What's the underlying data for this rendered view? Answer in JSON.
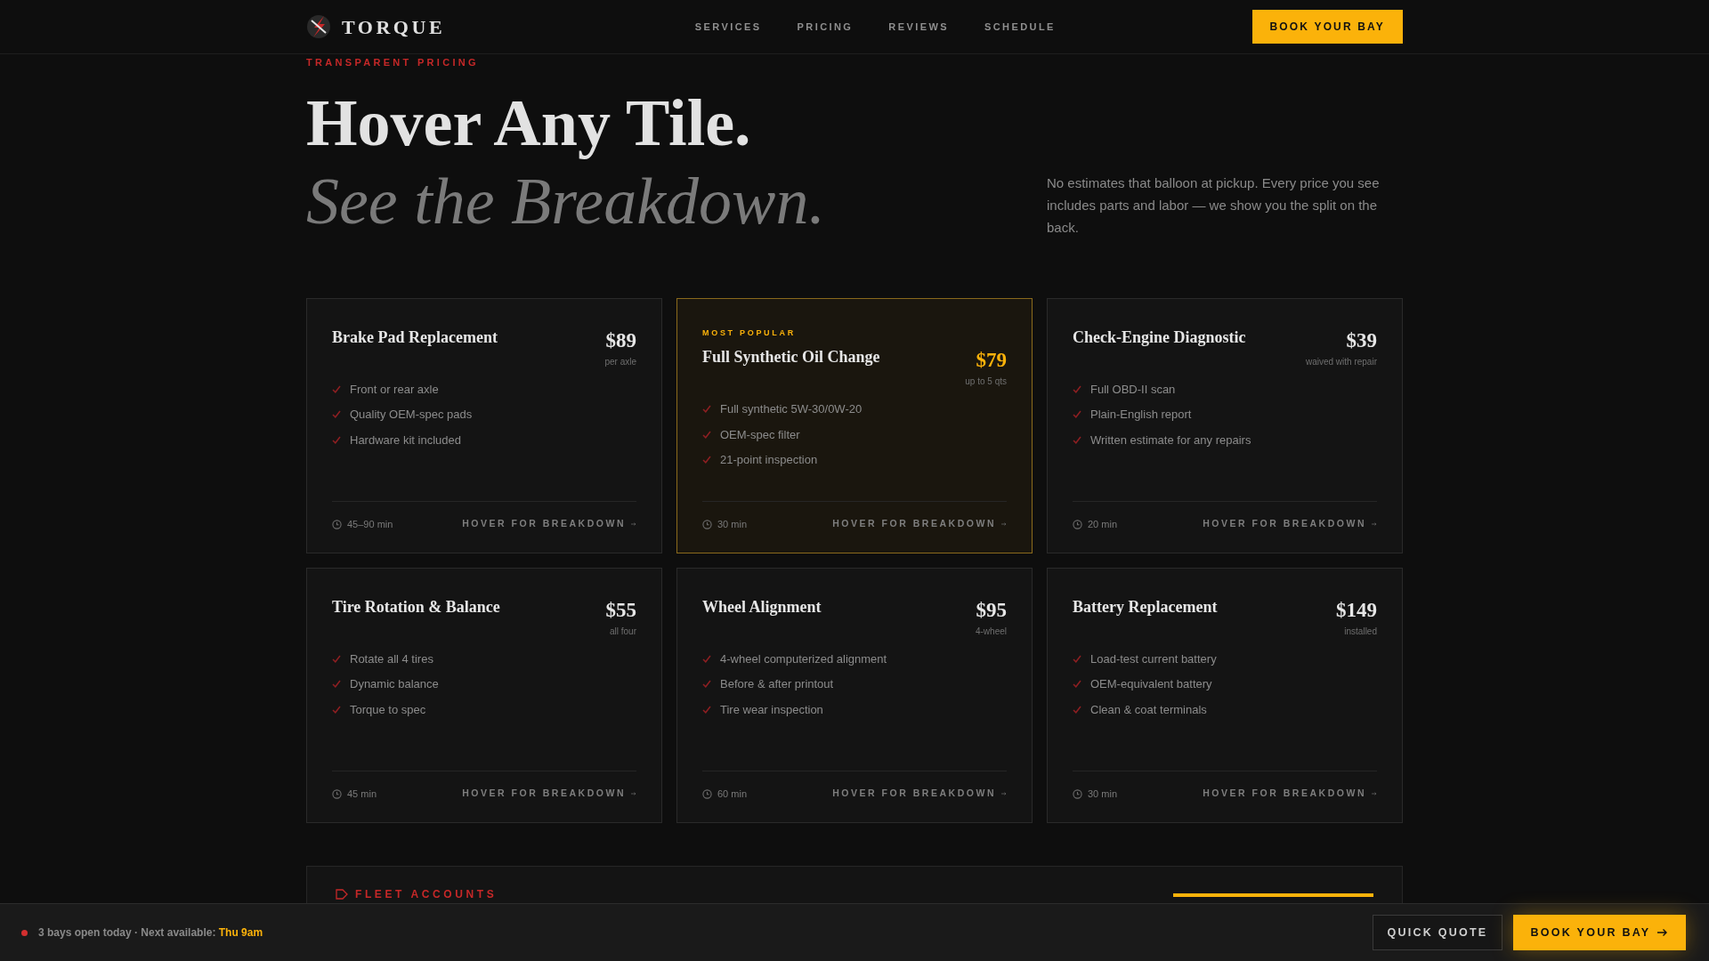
{
  "brand": {
    "name": "TORQUE"
  },
  "nav": [
    {
      "label": "SERVICES"
    },
    {
      "label": "PRICING"
    },
    {
      "label": "REVIEWS"
    },
    {
      "label": "SCHEDULE"
    }
  ],
  "header_button": "BOOK YOUR BAY",
  "eyebrow": "TRANSPARENT PRICING",
  "headline": "Hover Any Tile.",
  "subheadline": "See the Breakdown.",
  "intro": "No estimates that balloon at pickup. Every price you see includes parts and labor — we show you the split on the back.",
  "services": [
    {
      "title": "Brake Pad Replacement",
      "price": "$89",
      "unit": "per axle",
      "features": [
        "Front or rear axle",
        "Quality OEM-spec pads",
        "Hardware kit included"
      ],
      "duration": "45–90 min",
      "action": "HOVER FOR BREAKDOWN",
      "featured": false
    },
    {
      "title": "Full Synthetic Oil Change",
      "badge": "MOST POPULAR",
      "price": "$79",
      "unit": "up to 5 qts",
      "features": [
        "Full synthetic 5W-30/0W-20",
        "OEM-spec filter",
        "21-point inspection"
      ],
      "duration": "30 min",
      "action": "HOVER FOR BREAKDOWN",
      "featured": true
    },
    {
      "title": "Check-Engine Diagnostic",
      "price": "$39",
      "unit": "waived with repair",
      "features": [
        "Full OBD-II scan",
        "Plain-English report",
        "Written estimate for any repairs"
      ],
      "duration": "20 min",
      "action": "HOVER FOR BREAKDOWN",
      "featured": false
    },
    {
      "title": "Tire Rotation & Balance",
      "price": "$55",
      "unit": "all four",
      "features": [
        "Rotate all 4 tires",
        "Dynamic balance",
        "Torque to spec"
      ],
      "duration": "45 min",
      "action": "HOVER FOR BREAKDOWN",
      "featured": false
    },
    {
      "title": "Wheel Alignment",
      "price": "$95",
      "unit": "4-wheel",
      "features": [
        "4-wheel computerized alignment",
        "Before & after printout",
        "Tire wear inspection"
      ],
      "duration": "60 min",
      "action": "HOVER FOR BREAKDOWN",
      "featured": false
    },
    {
      "title": "Battery Replacement",
      "price": "$149",
      "unit": "installed",
      "features": [
        "Load-test current battery",
        "OEM-equivalent battery",
        "Clean & coat terminals"
      ],
      "duration": "30 min",
      "action": "HOVER FOR BREAKDOWN",
      "featured": false
    }
  ],
  "fleet": {
    "label": "FLEET ACCOUNTS"
  },
  "status_bar": {
    "text": "3 bays open today · Next available: **Thu 9am**",
    "buttons": [
      {
        "label": "QUICK QUOTE",
        "kind": "outline"
      },
      {
        "label": "BOOK YOUR BAY",
        "kind": "primary"
      }
    ]
  }
}
